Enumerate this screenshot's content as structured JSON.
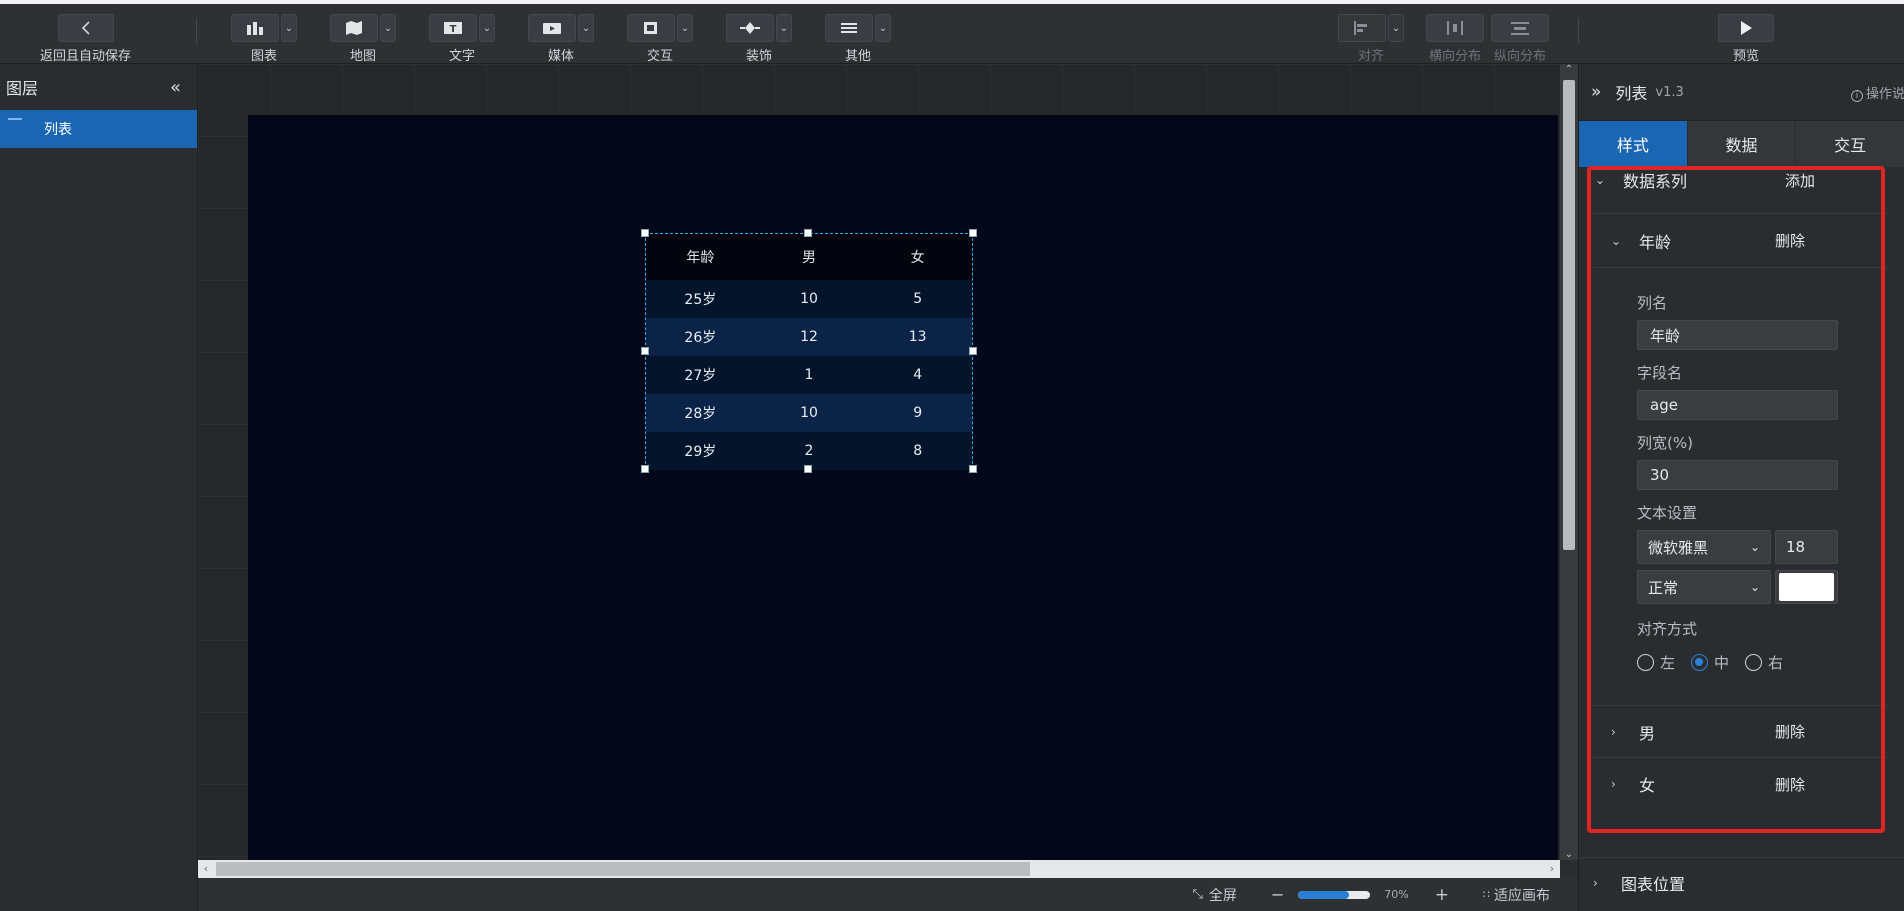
{
  "toolbar": {
    "back_label": "返回且自动保存",
    "tools": [
      {
        "label": "图表"
      },
      {
        "label": "地图"
      },
      {
        "label": "文字"
      },
      {
        "label": "媒体"
      },
      {
        "label": "交互"
      },
      {
        "label": "装饰"
      },
      {
        "label": "其他"
      }
    ],
    "align_label": "对齐",
    "hdist_label": "横向分布",
    "vdist_label": "纵向分布",
    "preview_label": "预览"
  },
  "layers": {
    "title": "图层",
    "items": [
      {
        "label": "列表"
      }
    ]
  },
  "table_widget": {
    "headers": [
      "年龄",
      "男",
      "女"
    ],
    "rows": [
      [
        "25岁",
        "10",
        "5"
      ],
      [
        "26岁",
        "12",
        "13"
      ],
      [
        "27岁",
        "1",
        "4"
      ],
      [
        "28岁",
        "10",
        "9"
      ],
      [
        "29岁",
        "2",
        "8"
      ]
    ]
  },
  "status": {
    "fullscreen_label": "全屏",
    "zoom_value": 0.7,
    "zoom_text": "70%",
    "fit_label": "适应画布"
  },
  "panel": {
    "title": "列表",
    "version": "v1.3",
    "help_label": "操作说明",
    "tabs": [
      "样式",
      "数据",
      "交互"
    ],
    "series_section": {
      "title": "数据系列",
      "add_label": "添加"
    },
    "columns": [
      {
        "name": "年龄",
        "delete_label": "删除"
      },
      {
        "name": "男",
        "delete_label": "删除"
      },
      {
        "name": "女",
        "delete_label": "删除"
      }
    ],
    "form": {
      "col_name_label": "列名",
      "col_name_value": "年龄",
      "field_label": "字段名",
      "field_value": "age",
      "width_label": "列宽(%)",
      "width_value": "30",
      "text_label": "文本设置",
      "font_value": "微软雅黑",
      "size_value": "18",
      "weight_value": "正常",
      "color_value": "#ffffff",
      "align_label": "对齐方式",
      "align_options": [
        "左",
        "中",
        "右"
      ],
      "align_selected": "中"
    },
    "position_section": "图表位置"
  }
}
